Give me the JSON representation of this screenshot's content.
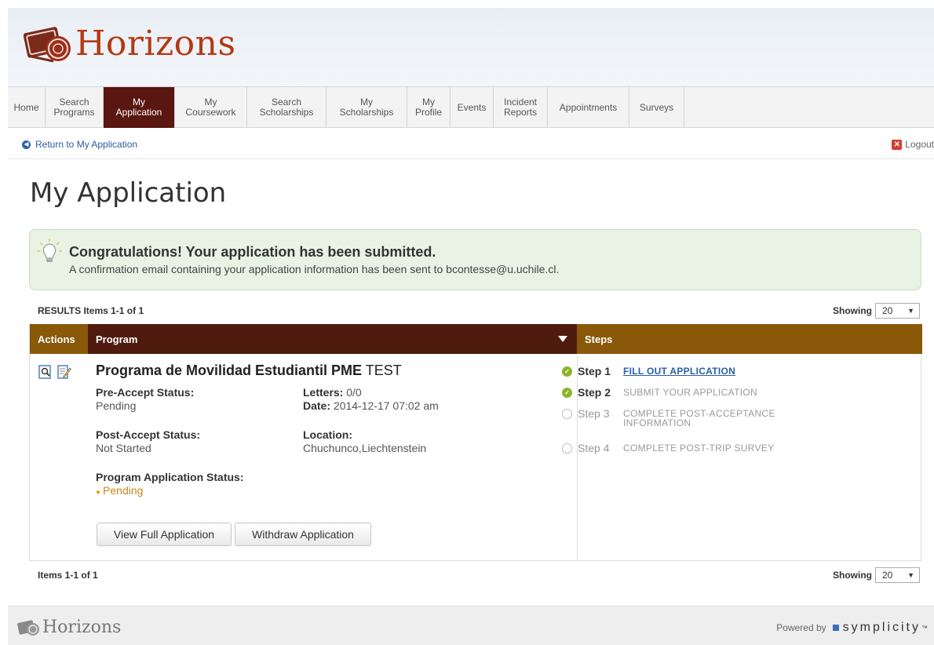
{
  "brand": {
    "name": "Horizons"
  },
  "nav": {
    "items": [
      {
        "id": "home",
        "label": "Home",
        "width": 48
      },
      {
        "id": "search-programs",
        "label": "Search\nPrograms",
        "width": 74
      },
      {
        "id": "my-application",
        "label": "My\nApplication",
        "width": 91,
        "active": true
      },
      {
        "id": "my-coursework",
        "label": "My\nCoursework",
        "width": 92
      },
      {
        "id": "search-scholarships",
        "label": "Search\nScholarships",
        "width": 101
      },
      {
        "id": "my-scholarships",
        "label": "My\nScholarships",
        "width": 103
      },
      {
        "id": "my-profile",
        "label": "My\nProfile",
        "width": 55
      },
      {
        "id": "events",
        "label": "Events",
        "width": 55
      },
      {
        "id": "incident-reports",
        "label": "Incident\nReports",
        "width": 69
      },
      {
        "id": "appointments",
        "label": "Appointments",
        "width": 104
      },
      {
        "id": "surveys",
        "label": "Surveys",
        "width": 70
      }
    ]
  },
  "util": {
    "return_label": "Return to My Application",
    "logout_label": "Logout"
  },
  "page": {
    "title": "My Application"
  },
  "alert": {
    "title": "Congratulations! Your application has been submitted.",
    "message": "A confirmation email containing your application information has been sent to bcontesse@u.uchile.cl."
  },
  "results": {
    "top_label": "RESULTS Items 1-1 of 1",
    "bottom_label": "Items 1-1 of 1",
    "showing_label": "Showing",
    "showing_value": "20"
  },
  "table": {
    "headers": {
      "actions": "Actions",
      "program": "Program",
      "steps": "Steps"
    },
    "row": {
      "program_name": "Programa de Movilidad Estudiantil PME",
      "program_suffix": "TEST",
      "pre_accept_label": "Pre-Accept Status:",
      "pre_accept_value": "Pending",
      "letters_label": "Letters:",
      "letters_value": "0/0",
      "date_label": "Date:",
      "date_value": "2014-12-17 07:02 am",
      "post_accept_label": "Post-Accept Status:",
      "post_accept_value": "Not Started",
      "location_label": "Location:",
      "location_value": "Chuchunco,Liechtenstein",
      "app_status_label": "Program Application Status:",
      "app_status_value": "Pending",
      "view_button": "View Full Application",
      "withdraw_button": "Withdraw Application"
    },
    "steps": [
      {
        "num": "Step 1",
        "desc": "FILL OUT APPLICATION",
        "done": true,
        "link": true
      },
      {
        "num": "Step 2",
        "desc": "SUBMIT YOUR APPLICATION",
        "done": true,
        "link": false
      },
      {
        "num": "Step 3",
        "desc": "COMPLETE POST-ACCEPTANCE INFORMATION",
        "done": false,
        "link": false
      },
      {
        "num": "Step 4",
        "desc": "COMPLETE POST-TRIP SURVEY",
        "done": false,
        "link": false
      }
    ]
  },
  "footer": {
    "brand": "Horizons",
    "powered_label": "Powered by",
    "vendor": "symplicity",
    "tm": "™"
  },
  "colors": {
    "brand_red": "#b33a12",
    "nav_active": "#5a1611",
    "header_gold": "#8a5809",
    "header_dark": "#4f1b0e",
    "link_blue": "#2a5ea8",
    "check_green": "#8ab52b"
  }
}
